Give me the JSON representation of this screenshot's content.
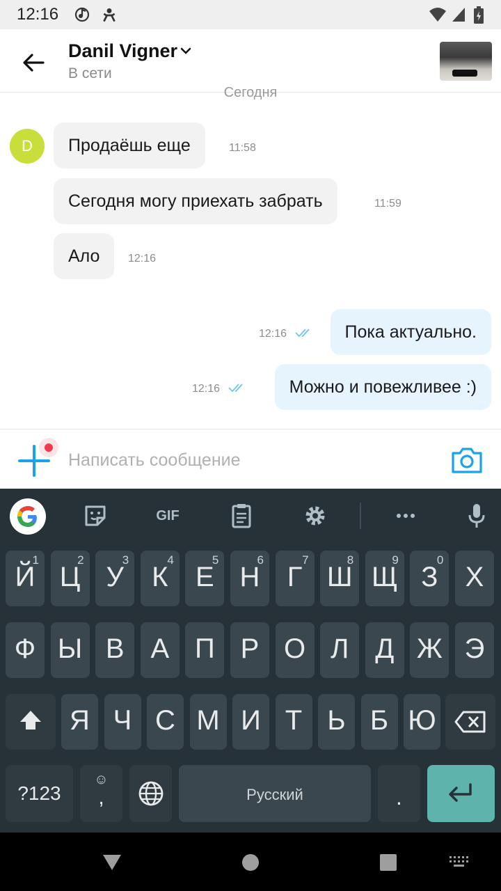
{
  "status_bar": {
    "time": "12:16"
  },
  "header": {
    "contact_name": "Danil Vigner",
    "contact_status": "В сети"
  },
  "chat": {
    "date_label": "Сегодня",
    "avatar_letter": "D",
    "incoming": [
      {
        "text": "Продаёшь еще",
        "time": "11:58"
      },
      {
        "text": "Сегодня могу приехать забрать",
        "time": "11:59"
      },
      {
        "text": "Ало",
        "time": "12:16"
      }
    ],
    "outgoing": [
      {
        "text": "Пока актуально.",
        "time": "12:16"
      },
      {
        "text": "Можно и повежливее :)",
        "time": "12:16"
      }
    ]
  },
  "composer": {
    "placeholder": "Написать сообщение"
  },
  "keyboard": {
    "toolbar": {
      "gif_label": "GIF"
    },
    "row1": [
      {
        "k": "Й",
        "h": "1"
      },
      {
        "k": "Ц",
        "h": "2"
      },
      {
        "k": "У",
        "h": "3"
      },
      {
        "k": "К",
        "h": "4"
      },
      {
        "k": "Е",
        "h": "5"
      },
      {
        "k": "Н",
        "h": "6"
      },
      {
        "k": "Г",
        "h": "7"
      },
      {
        "k": "Ш",
        "h": "8"
      },
      {
        "k": "Щ",
        "h": "9"
      },
      {
        "k": "З",
        "h": "0"
      },
      {
        "k": "Х",
        "h": ""
      }
    ],
    "row2": [
      "Ф",
      "Ы",
      "В",
      "А",
      "П",
      "Р",
      "О",
      "Л",
      "Д",
      "Ж",
      "Э"
    ],
    "row3": [
      "Я",
      "Ч",
      "С",
      "М",
      "И",
      "Т",
      "Ь",
      "Б",
      "Ю"
    ],
    "symbols_label": "?123",
    "emoji_key_label": "☺",
    "comma_label": ",",
    "space_label": "Русский",
    "period_label": "."
  }
}
